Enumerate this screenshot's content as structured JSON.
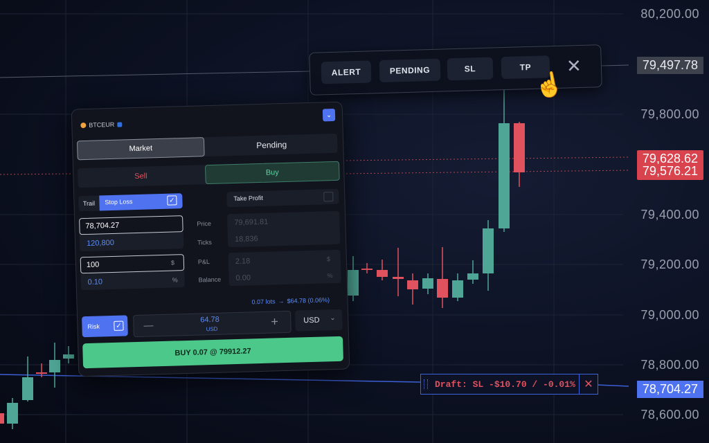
{
  "axis": {
    "labels": [
      "80,200.00",
      "79,800.00",
      "79,400.00",
      "79,200.00",
      "79,000.00",
      "78,800.00",
      "78,600.00"
    ],
    "tag_current": "79,497.78",
    "tag_red_1": "79,628.62",
    "tag_red_2": "79,576.21",
    "tag_blue": "78,704.27"
  },
  "toolbar": {
    "alert": "ALERT",
    "pending": "PENDING",
    "sl": "SL",
    "tp": "TP",
    "close": "✕",
    "cursor": "☝"
  },
  "panel": {
    "symbol": "BTCEUR",
    "tab_market": "Market",
    "tab_pending": "Pending",
    "sell": "Sell",
    "buy": "Buy",
    "trail": "Trail",
    "stop_loss": "Stop Loss",
    "stop_loss_checked": "✓",
    "take_profit": "Take Profit",
    "sl_price": "78,704.27",
    "sl_ticks": "120,800",
    "sl_amount": "100",
    "sl_amount_unit": "$",
    "sl_percent": "0.10",
    "sl_percent_unit": "%",
    "label_price": "Price",
    "label_ticks": "Ticks",
    "label_pnl": "P&L",
    "label_balance": "Balance",
    "tp_price": "79,691.81",
    "tp_ticks": "18,836",
    "tp_pnl": "2.18",
    "tp_pnl_unit": "$",
    "tp_balance": "0.00",
    "tp_balance_unit": "%",
    "lots_summary": "0.07 lots",
    "lots_arrow": "→",
    "lots_value": "$64.78 (0.06%)",
    "risk": "Risk",
    "risk_checked": "✓",
    "minus": "—",
    "plus": "+",
    "risk_value": "64.78",
    "risk_unit": "USD",
    "currency": "USD",
    "buy_button": "BUY 0.07 @ 79912.27"
  },
  "draft": {
    "text": "Draft: SL -$10.70 / -0.01%",
    "close": "✕"
  },
  "colors": {
    "up": "#4fa696",
    "down": "#e0525d",
    "blue": "#4f72f0",
    "green_btn": "#3fc481"
  }
}
